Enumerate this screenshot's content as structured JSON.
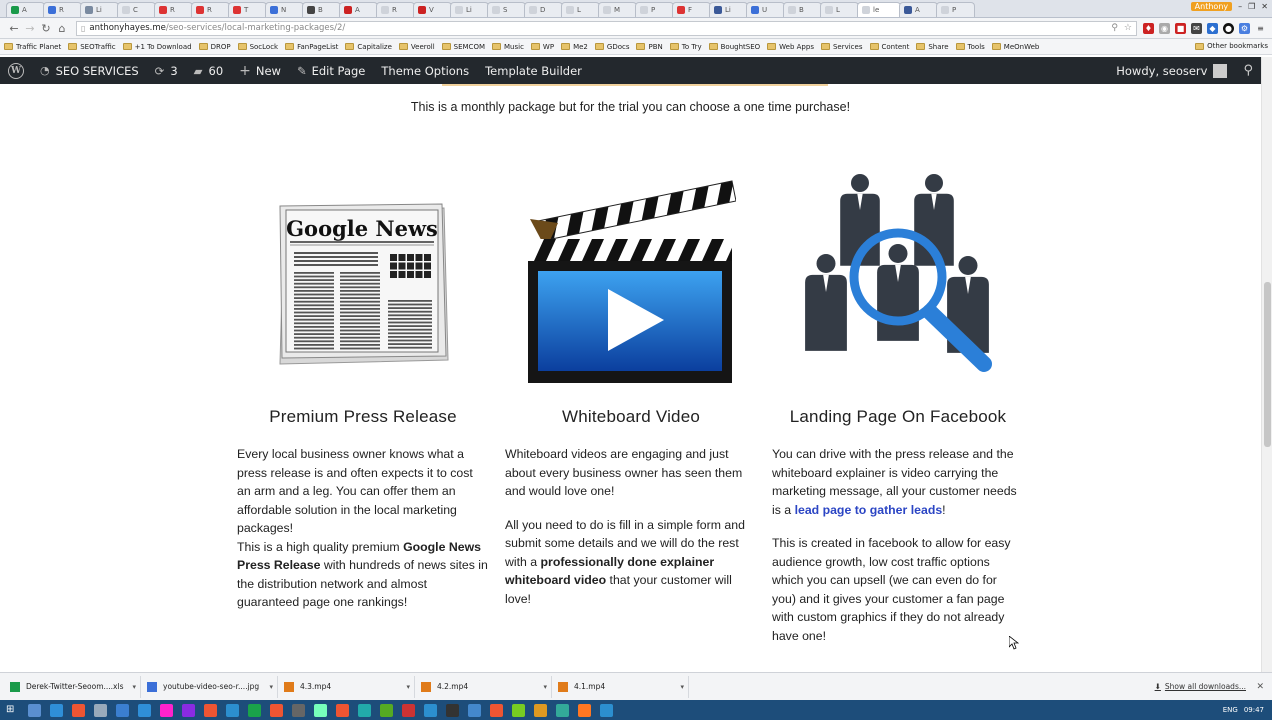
{
  "browser": {
    "tabs": [
      {
        "label": "A",
        "color": "#1a9a4a"
      },
      {
        "label": "R",
        "color": "#3b6fd8"
      },
      {
        "label": "Li",
        "color": "#7a8aa0"
      },
      {
        "label": "C",
        "color": "#cfd3da"
      },
      {
        "label": "R",
        "color": "#d33"
      },
      {
        "label": "R",
        "color": "#d33"
      },
      {
        "label": "T",
        "color": "#d33"
      },
      {
        "label": "N",
        "color": "#3b6fd8"
      },
      {
        "label": "B",
        "color": "#444"
      },
      {
        "label": "A",
        "color": "#c22"
      },
      {
        "label": "R",
        "color": "#cfd3da"
      },
      {
        "label": "V",
        "color": "#c22"
      },
      {
        "label": "Li",
        "color": "#cfd3da"
      },
      {
        "label": "S",
        "color": "#cfd3da"
      },
      {
        "label": "D",
        "color": "#cfd3da"
      },
      {
        "label": "L",
        "color": "#cfd3da"
      },
      {
        "label": "M",
        "color": "#cfd3da"
      },
      {
        "label": "P",
        "color": "#cfd3da"
      },
      {
        "label": "F",
        "color": "#d33"
      },
      {
        "label": "Li",
        "color": "#3b5998"
      },
      {
        "label": "U",
        "color": "#3b6fd8"
      },
      {
        "label": "B",
        "color": "#cfd3da"
      },
      {
        "label": "L",
        "color": "#cfd3da"
      },
      {
        "label": "le",
        "color": "#cfd3da"
      },
      {
        "label": "A",
        "color": "#3b5998"
      },
      {
        "label": "P",
        "color": "#cfd3da"
      }
    ],
    "window_user": "Anthony",
    "url_host": "anthonyhayes.me",
    "url_path": "/seo-services/local-marketing-packages/2/",
    "bookmarks": [
      "MeOnWeb",
      "Tools",
      "Share",
      "Content",
      "Services",
      "Web Apps",
      "BoughtSEO",
      "To Try",
      "PBN",
      "GDocs",
      "Me2",
      "WP",
      "Music",
      "SEMCOM",
      "Veeroll",
      "Capitalize",
      "FanPageList",
      "SocLock",
      "DROP",
      "+1 To Download",
      "SEOTraffic",
      "Traffic Planet"
    ],
    "other_bookmarks": "Other bookmarks"
  },
  "wpbar": {
    "site_name": "SEO SERVICES",
    "updates_count": "3",
    "comments_count": "60",
    "new_label": "New",
    "edit_label": "Edit Page",
    "theme_label": "Theme Options",
    "builder_label": "Template Builder",
    "howdy": "Howdy, seoserv"
  },
  "page": {
    "monthly_note": "This is a monthly package but for the trial you can choose a one time purchase!",
    "col1": {
      "news_title": "Google News",
      "title": "Premium Press Release",
      "p1": "Every local business owner knows what a press release is and often expects it to cost an arm and a leg. You can offer them an affordable solution in the local marketing packages!",
      "p2a": "This is a high quality premium ",
      "p2b": "Google News Press Release",
      "p2c": " with hundreds of news sites in the distribution network and almost guaranteed page one rankings!"
    },
    "col2": {
      "title": "Whiteboard Video",
      "p1": "Whiteboard videos are engaging and just about every business owner has seen them and would love one!",
      "p2a": "All you need to do is fill in a simple form and submit some details and we will do the rest with a ",
      "p2b": "professionally done explainer whiteboard video",
      "p2c": " that your customer will love!"
    },
    "col3": {
      "title": "Landing Page On Facebook",
      "p1a": "You can drive with the press release and the whiteboard explainer is video carrying the marketing message, all your customer needs is a ",
      "p1link": "lead page to gather leads",
      "p1b": "!",
      "p2": "This is created in facebook to allow for easy audience growth, low cost traffic options which you can upsell (we can even do for you) and it gives your customer a fan page with custom graphics if they do not already have one!"
    }
  },
  "downloads": {
    "items": [
      {
        "name": "Derek-Twitter-Seoom....xls",
        "color": "#1a9a4a"
      },
      {
        "name": "youtube-video-seo-r....jpg",
        "color": "#3b6fd8"
      },
      {
        "name": "4.3.mp4",
        "color": "#e07b1a"
      },
      {
        "name": "4.2.mp4",
        "color": "#e07b1a"
      },
      {
        "name": "4.1.mp4",
        "color": "#e07b1a"
      }
    ],
    "show_all": "Show all downloads..."
  },
  "taskbar": {
    "lang": "ENG",
    "time": "09:47",
    "icons": [
      "#5a8fd0",
      "#2f8fd8",
      "#e53",
      "#9ab",
      "#3b7fd0",
      "#2f8fd8",
      "#f2c",
      "#8a2be2",
      "#e53",
      "#2c8fcf",
      "#1aa34a",
      "#e53",
      "#666",
      "#7fb",
      "#e53",
      "#2aa",
      "#5a2",
      "#c33",
      "#2c8fcf",
      "#333",
      "#48c",
      "#e53",
      "#7c2",
      "#d92",
      "#3a9",
      "#f72",
      "#2c8fcf"
    ]
  }
}
